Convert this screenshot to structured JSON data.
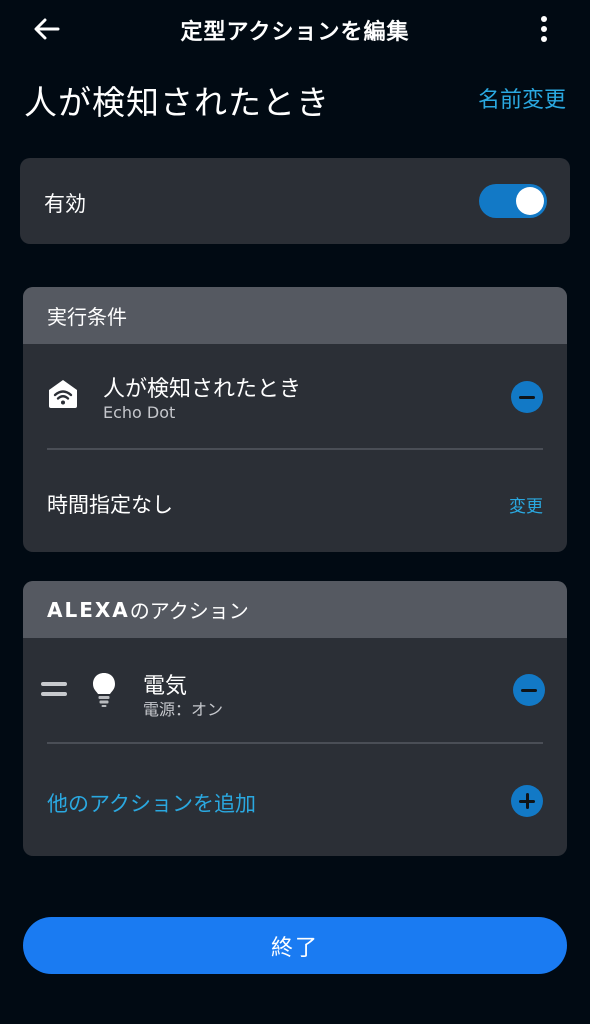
{
  "header": {
    "title": "定型アクションを編集",
    "back_icon": "arrow-left-icon",
    "more_icon": "more-vertical-icon"
  },
  "routine": {
    "name": "人が検知されたとき",
    "rename_label": "名前変更"
  },
  "enabled": {
    "label": "有効",
    "state": true
  },
  "conditions": {
    "header": "実行条件",
    "trigger": {
      "icon": "home-wifi-icon",
      "title": "人が検知されたとき",
      "device": "Echo Dot"
    },
    "schedule": {
      "label": "時間指定なし",
      "change_label": "変更"
    }
  },
  "actions": {
    "header_brand": "ALEXA",
    "header_suffix": "のアクション",
    "items": [
      {
        "icon": "light-bulb-icon",
        "title": "電気",
        "detail": "電源：オン"
      }
    ],
    "add_label": "他のアクションを追加"
  },
  "footer": {
    "done_label": "終了"
  },
  "colors": {
    "background": "#010a13",
    "card": "#2b2f36",
    "card_header": "#555961",
    "accent": "#1279c6",
    "link": "#2aa8e0",
    "primary_button": "#1a7bf2"
  }
}
